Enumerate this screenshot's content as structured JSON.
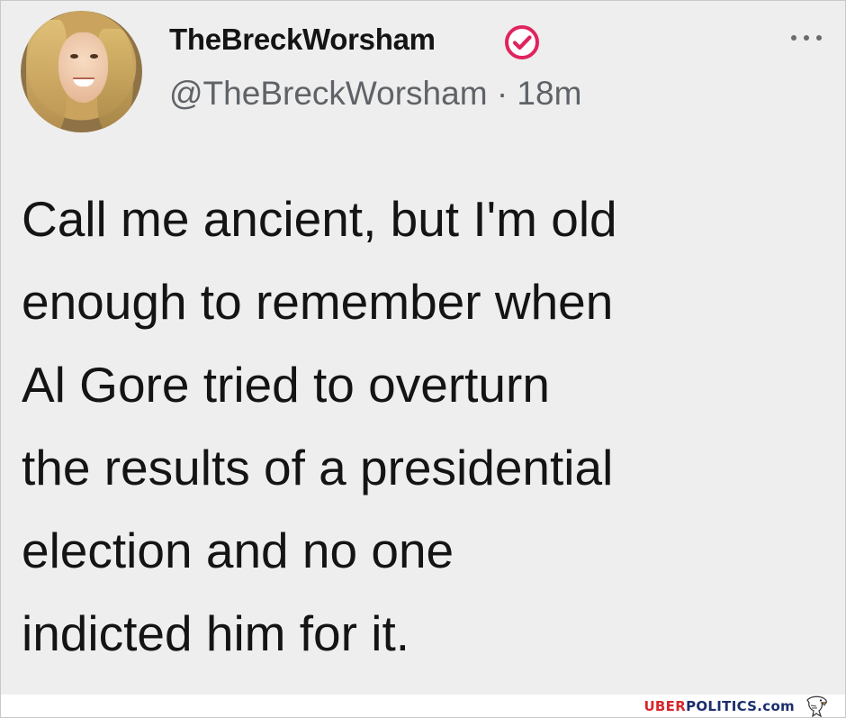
{
  "tweet": {
    "display_name": "TheBreckWorsham",
    "handle": "@TheBreckWorsham",
    "separator": "·",
    "time": "18m",
    "more_icon": "more-horizontal-icon",
    "text_lines": [
      "Call me ancient, but I'm old",
      "enough to remember when",
      "Al Gore tried to overturn",
      "the results of a presidential",
      "election and no one",
      "indicted him for it."
    ]
  },
  "watermark": {
    "part1": "UBER",
    "part2": "POLITICS.com",
    "logo_icon": "eagle-icon"
  },
  "colors": {
    "verified_badge": "#e0245e",
    "watermark_red": "#d8262c",
    "watermark_blue": "#1c2e6e",
    "card_background": "#eeeeee"
  }
}
